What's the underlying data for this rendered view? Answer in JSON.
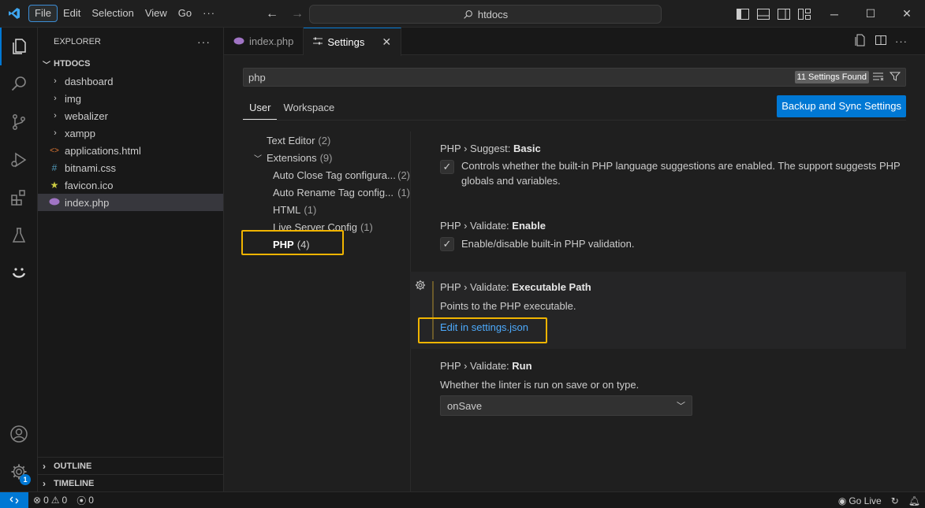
{
  "titlebar": {
    "menu": [
      "File",
      "Edit",
      "Selection",
      "View",
      "Go",
      "···"
    ],
    "search_text": "htdocs"
  },
  "explorer": {
    "title": "EXPLORER",
    "more": "···",
    "folder": "HTDOCS",
    "items": [
      {
        "label": "dashboard",
        "kind": "folder"
      },
      {
        "label": "img",
        "kind": "folder"
      },
      {
        "label": "webalizer",
        "kind": "folder"
      },
      {
        "label": "xampp",
        "kind": "folder"
      },
      {
        "label": "applications.html",
        "kind": "html-file",
        "icon_glyph": "<>",
        "icon_color": "#e37933"
      },
      {
        "label": "bitnami.css",
        "kind": "css-file",
        "icon_glyph": "#",
        "icon_color": "#519aba"
      },
      {
        "label": "favicon.ico",
        "kind": "ico-file",
        "icon_glyph": "★",
        "icon_color": "#cbcb41"
      },
      {
        "label": "index.php",
        "kind": "php-file",
        "icon_color": "#a074c4",
        "selected": true
      }
    ],
    "outline": "OUTLINE",
    "timeline": "TIMELINE"
  },
  "tabs": [
    {
      "label": "index.php",
      "active": false
    },
    {
      "label": "Settings",
      "active": true,
      "close": "✕"
    }
  ],
  "settings": {
    "search_value": "php",
    "found_text": "11 Settings Found",
    "scopes": [
      "User",
      "Workspace"
    ],
    "sync_button": "Backup and Sync Settings",
    "toc": [
      {
        "label": "Text Editor",
        "count": "(2)",
        "indent": 1
      },
      {
        "label": "Extensions",
        "count": "(9)",
        "indent": 0,
        "expanded": true
      },
      {
        "label": "Auto Close Tag configura...",
        "count": "(2)",
        "indent": 2
      },
      {
        "label": "Auto Rename Tag config...",
        "count": "(1)",
        "indent": 2
      },
      {
        "label": "HTML",
        "count": "(1)",
        "indent": 2
      },
      {
        "label": "Live Server Config",
        "count": "(1)",
        "indent": 2
      },
      {
        "label": "PHP",
        "count": "(4)",
        "indent": 2,
        "bold": true
      }
    ],
    "items": [
      {
        "prefix": "PHP › Suggest: ",
        "name": "Basic",
        "description": "Controls whether the built-in PHP language suggestions are enabled. The support suggests PHP globals and variables.",
        "checked": true
      },
      {
        "prefix": "PHP › Validate: ",
        "name": "Enable",
        "description": "Enable/disable built-in PHP validation.",
        "checked": true
      },
      {
        "prefix": "PHP › Validate: ",
        "name": "Executable Path",
        "description": "Points to the PHP executable.",
        "link": "Edit in settings.json"
      },
      {
        "prefix": "PHP › Validate: ",
        "name": "Run",
        "description": "Whether the linter is run on save or on type.",
        "select_value": "onSave"
      }
    ]
  },
  "statusbar": {
    "errors": "0",
    "warnings": "0",
    "ports": "0",
    "go_live": "Go Live"
  },
  "accounts_badge": "1",
  "colors": {
    "accent": "#0078d4",
    "highlight": "#f0b400",
    "link": "#4daafc"
  }
}
